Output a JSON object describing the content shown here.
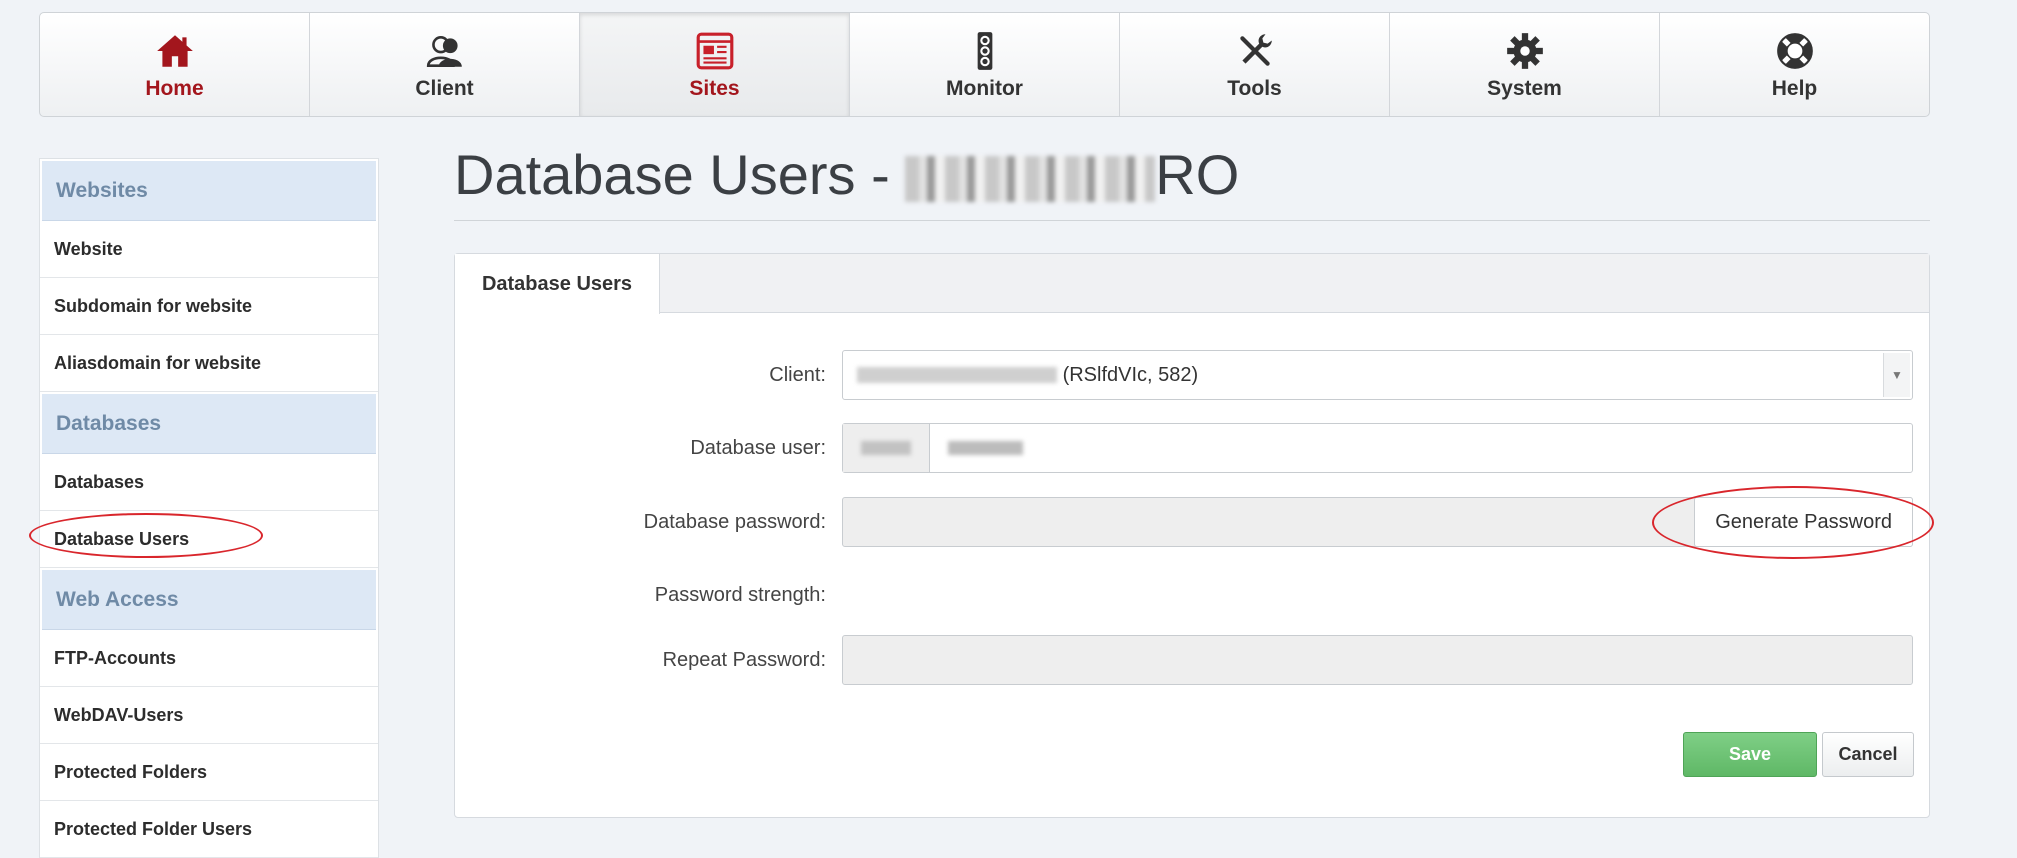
{
  "nav": {
    "items": [
      {
        "label": "Home",
        "icon": "home-icon"
      },
      {
        "label": "Client",
        "icon": "client-icon"
      },
      {
        "label": "Sites",
        "icon": "sites-icon"
      },
      {
        "label": "Monitor",
        "icon": "monitor-icon"
      },
      {
        "label": "Tools",
        "icon": "tools-icon"
      },
      {
        "label": "System",
        "icon": "gear-icon"
      },
      {
        "label": "Help",
        "icon": "help-icon"
      }
    ],
    "active": "Sites",
    "accent_color": "#a3161d"
  },
  "sidebar": {
    "sections": [
      {
        "title": "Websites",
        "items": [
          "Website",
          "Subdomain for website",
          "Aliasdomain for website"
        ]
      },
      {
        "title": "Databases",
        "items": [
          "Databases",
          "Database Users"
        ]
      },
      {
        "title": "Web Access",
        "items": [
          "FTP-Accounts",
          "WebDAV-Users",
          "Protected Folders",
          "Protected Folder Users"
        ]
      }
    ]
  },
  "page": {
    "title_prefix": "Database Users - ",
    "title_suffix": "RO"
  },
  "panel": {
    "tab_label": "Database Users"
  },
  "form": {
    "client_label": "Client:",
    "client_value": "(RSlfdVIc, 582)",
    "db_user_label": "Database user:",
    "db_password_label": "Database password:",
    "generate_password_label": "Generate Password",
    "strength_label": "Password strength:",
    "repeat_label": "Repeat Password:",
    "save_label": "Save",
    "cancel_label": "Cancel"
  },
  "colors": {
    "save_green": "#5fb866",
    "annotation_red": "#d9262c",
    "sidebar_header_bg": "#dde8f5"
  }
}
